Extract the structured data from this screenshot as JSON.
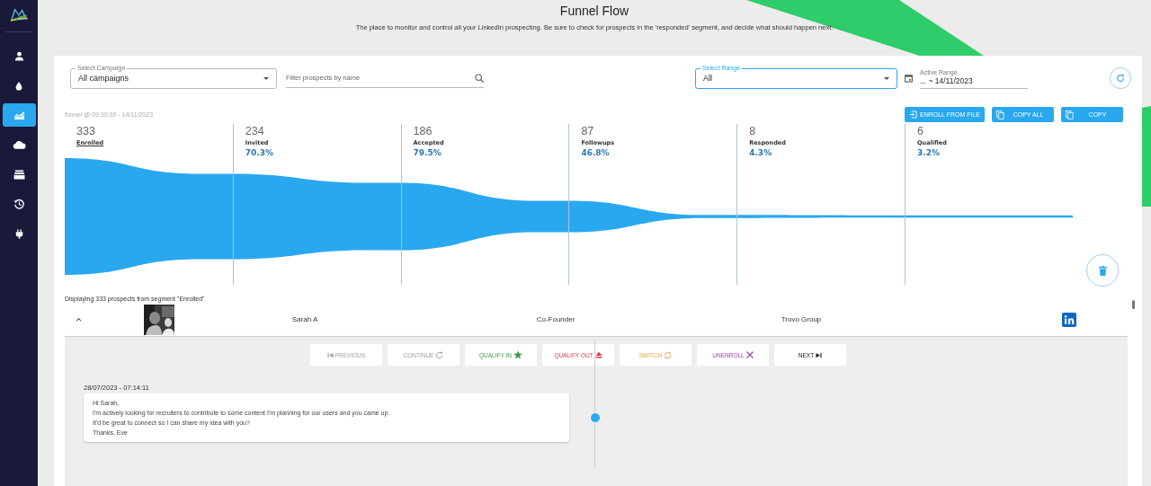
{
  "sidebar": {
    "items": [
      {
        "kind": "person",
        "selected": false
      },
      {
        "kind": "drop",
        "selected": false
      },
      {
        "kind": "chart",
        "selected": true
      },
      {
        "kind": "cloud",
        "selected": false
      },
      {
        "kind": "inbox",
        "selected": false
      },
      {
        "kind": "history",
        "selected": false
      },
      {
        "kind": "plug",
        "selected": false
      }
    ]
  },
  "header": {
    "title": "Funnel Flow",
    "subtitle": "The place to monitor and control all your LinkedIn prospecting. Be sure to check for prospects in the 'responded' segment, and decide what should happen next."
  },
  "filters": {
    "campaign": {
      "label": "Select Campaign",
      "value": "All campaigns"
    },
    "search": {
      "placeholder": "Filter prospects by name"
    },
    "range": {
      "label": "Select Range",
      "value": "All",
      "focused": true
    },
    "active_range": {
      "label": "Active Range",
      "value": "... ~ 14/11/2023"
    }
  },
  "funnel": {
    "timestamp": "funnel @ 09:30:00 - 14/11/2023",
    "actions": [
      {
        "label": "ENROLL FROM FILE",
        "kind": "enroll"
      },
      {
        "label": "COPY ALL",
        "kind": "copy"
      },
      {
        "label": "COPY",
        "kind": "copy"
      }
    ],
    "stages": [
      {
        "count": "333",
        "label": "Enrolled",
        "selected": true
      },
      {
        "count": "234",
        "label": "Invited",
        "rate": "70.3%",
        "selected": false
      },
      {
        "count": "186",
        "label": "Accepted",
        "rate": "79.5%",
        "selected": false
      },
      {
        "count": "87",
        "label": "Followups",
        "rate": "46.8%",
        "selected": false
      },
      {
        "count": "8",
        "label": "Responded",
        "rate": "4.3%",
        "selected": false
      },
      {
        "count": "6",
        "label": "Qualified",
        "rate": "3.2%",
        "selected": false
      }
    ]
  },
  "segment_note": "Displaying 333 prospects from segment \"Enrolled\"",
  "prospect": {
    "name": "Sarah A",
    "title": "Co-Founder",
    "company": "Trovo Group",
    "expanded": true,
    "actions": [
      {
        "label": "PREVIOUS",
        "kind": "previous",
        "disabled": true
      },
      {
        "label": "CONTINUE",
        "kind": "continue",
        "disabled": true
      },
      {
        "label": "QUALIFY IN",
        "kind": "qualify_in",
        "disabled": false
      },
      {
        "label": "QUALIFY OUT",
        "kind": "qualify_out",
        "disabled": false
      },
      {
        "label": "SWITCH",
        "kind": "switch",
        "disabled": false
      },
      {
        "label": "UNENROLL",
        "kind": "unenroll",
        "disabled": false
      },
      {
        "label": "NEXT",
        "kind": "next",
        "disabled": false
      }
    ],
    "messages": [
      {
        "date": "28/07/2023 - 07:14:11",
        "text": "Hi Sarah,\nI'm actively looking for recruiters to contribute to some content I'm planning for our users and you came up.\nIt'd be great to connect so I can share my idea with you?\nThanks, Eve"
      }
    ]
  }
}
